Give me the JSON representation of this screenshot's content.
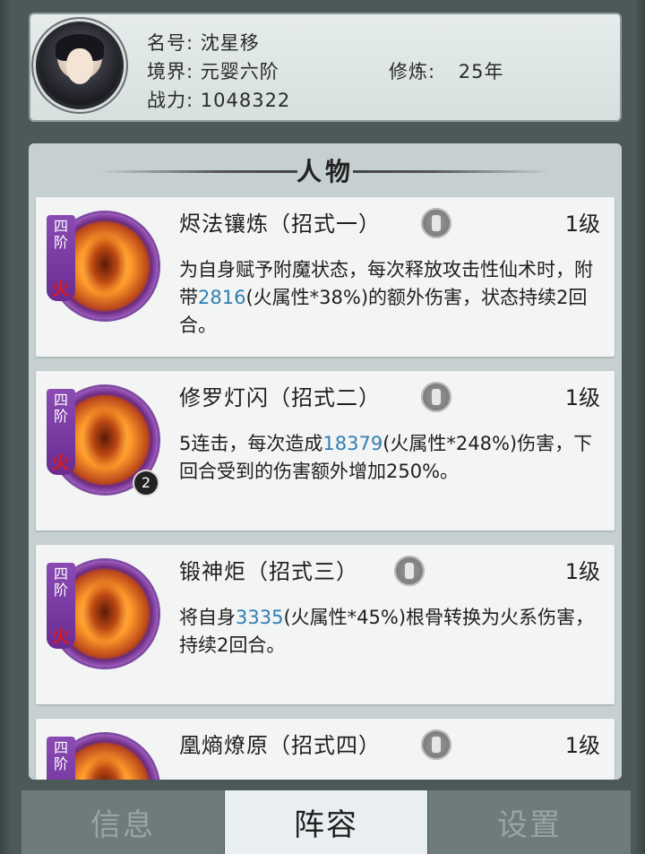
{
  "profile": {
    "name_label": "名号:",
    "name": "沈星移",
    "realm_label": "境界:",
    "realm": "元婴六阶",
    "cultivation_label": "修炼:",
    "cultivation": "25年",
    "power_label": "战力:",
    "power": "1048322"
  },
  "section": {
    "title": "人物"
  },
  "skills": [
    {
      "tier": "四阶",
      "element": "火",
      "name": "烬法镶炼（招式一）",
      "level": "1级",
      "desc_parts": [
        "为自身赋予附魔状态，每次释放攻击性仙术时，附带",
        "2816",
        "(火属性*38%)的额外伤害，状态持续2回合。"
      ]
    },
    {
      "tier": "四阶",
      "element": "火",
      "badge": "2",
      "name": "修罗灯闪（招式二）",
      "level": "1级",
      "desc_parts": [
        "5连击，每次造成",
        "18379",
        "(火属性*248%)伤害，下回合受到的伤害额外增加250%。"
      ]
    },
    {
      "tier": "四阶",
      "element": "火",
      "name": "锻神炬（招式三）",
      "level": "1级",
      "desc_parts": [
        "将自身",
        "3335",
        "(火属性*45%)根骨转换为火系伤害，持续2回合。"
      ]
    },
    {
      "tier": "四阶",
      "name": "凰熵燎原（招式四）",
      "level": "1级"
    }
  ],
  "tabs": {
    "info": "信息",
    "lineup": "阵容",
    "settings": "设置"
  },
  "icons": {
    "avatar": "character-portrait",
    "skill_type": "skill-type-icon",
    "orb": "fire-skill-orb"
  }
}
